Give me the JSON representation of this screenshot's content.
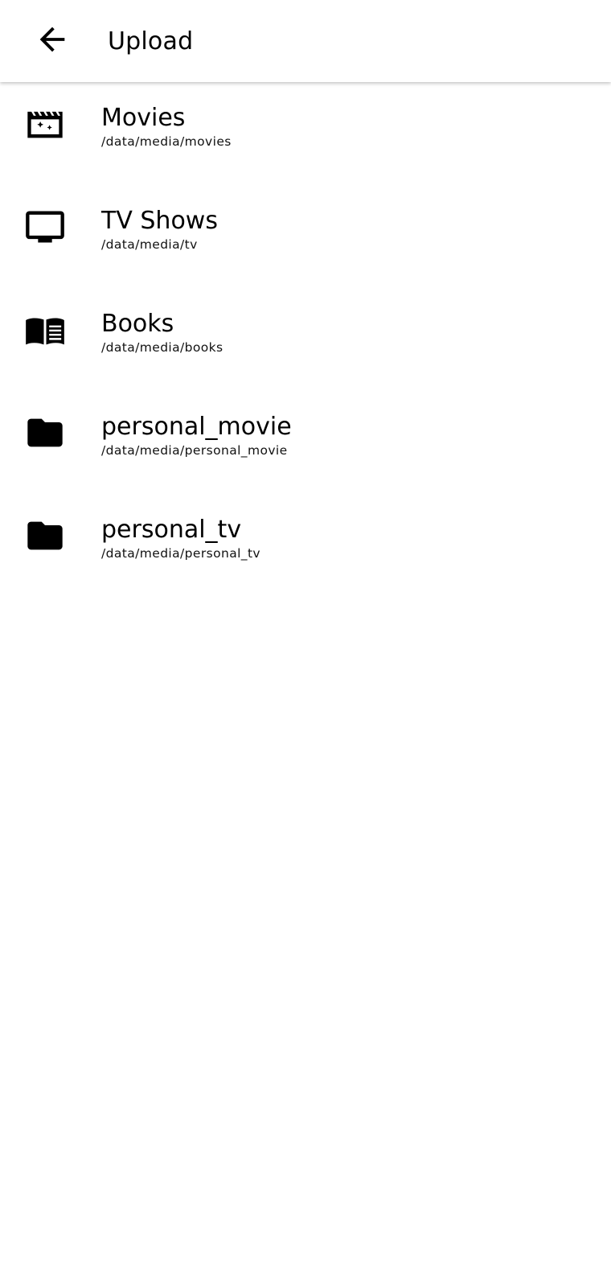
{
  "appbar": {
    "title": "Upload",
    "back_icon": "arrow-back-icon"
  },
  "libraries": [
    {
      "title": "Movies",
      "path": "/data/media/movies",
      "icon": "movie-icon"
    },
    {
      "title": "TV Shows",
      "path": "/data/media/tv",
      "icon": "tv-icon"
    },
    {
      "title": "Books",
      "path": "/data/media/books",
      "icon": "book-icon"
    },
    {
      "title": "personal_movie",
      "path": "/data/media/personal_movie",
      "icon": "folder-icon"
    },
    {
      "title": "personal_tv",
      "path": "/data/media/personal_tv",
      "icon": "folder-icon"
    }
  ]
}
